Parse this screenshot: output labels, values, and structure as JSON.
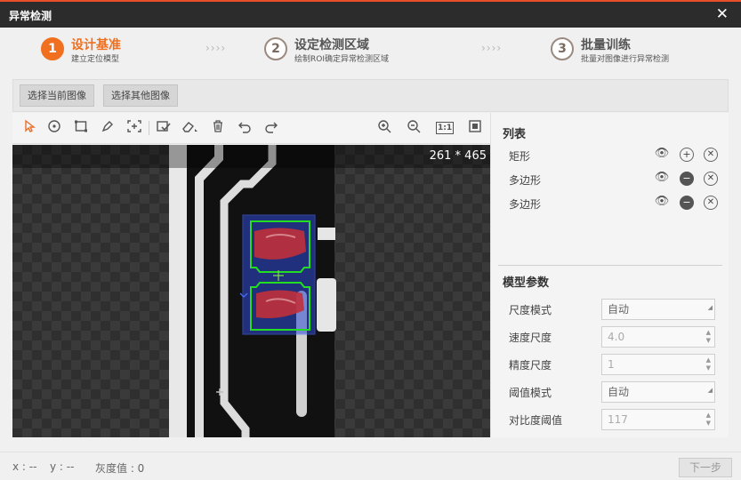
{
  "window": {
    "title": "异常检测",
    "close_icon": "close-icon"
  },
  "steps": [
    {
      "number": "1",
      "label": "设计基准",
      "sub": "建立定位模型",
      "active": true
    },
    {
      "number": "2",
      "label": "设定检测区域",
      "sub": "绘制ROI确定异常检测区域",
      "active": false
    },
    {
      "number": "3",
      "label": "批量训练",
      "sub": "批量对图像进行异常检测",
      "active": false
    }
  ],
  "step_separator": "››››",
  "image_buttons": {
    "current": "选择当前图像",
    "other": "选择其他图像"
  },
  "toolbar": {
    "icons": [
      "pointer-icon",
      "circle-tool-icon",
      "rectangle-tool-icon",
      "pen-tool-icon",
      "crosshair-add-icon",
      "checklist-icon",
      "eraser-icon",
      "delete-icon",
      "undo-icon",
      "redo-icon",
      "zoom-in-icon",
      "zoom-out-icon",
      "actual-size-icon",
      "fit-window-icon"
    ],
    "actual_size_label": "1:1"
  },
  "canvas": {
    "dimensions": "261 * 465"
  },
  "list": {
    "title": "列表",
    "items": [
      {
        "name": "矩形",
        "action": "plus"
      },
      {
        "name": "多边形",
        "action": "minus"
      },
      {
        "name": "多边形",
        "action": "minus"
      }
    ]
  },
  "model_params": {
    "title": "模型参数",
    "fields": [
      {
        "label": "尺度模式",
        "value": "自动",
        "kind": "dropdown",
        "enabled": true
      },
      {
        "label": "速度尺度",
        "value": "4.0",
        "kind": "spinner",
        "enabled": false
      },
      {
        "label": "精度尺度",
        "value": "1",
        "kind": "spinner",
        "enabled": false
      },
      {
        "label": "阈值模式",
        "value": "自动",
        "kind": "dropdown",
        "enabled": true
      },
      {
        "label": "对比度阈值",
        "value": "117",
        "kind": "spinner",
        "enabled": false
      }
    ]
  },
  "status": {
    "x": "x : --",
    "y": "y : --",
    "gray": "灰度值 : 0"
  },
  "next_button": "下一步",
  "colors": {
    "accent": "#f07020",
    "title_bar": "#2c2c2c",
    "roi_box": "#3b5bdb",
    "roi_outline": "#22dd22",
    "defect": "#c0303a"
  }
}
